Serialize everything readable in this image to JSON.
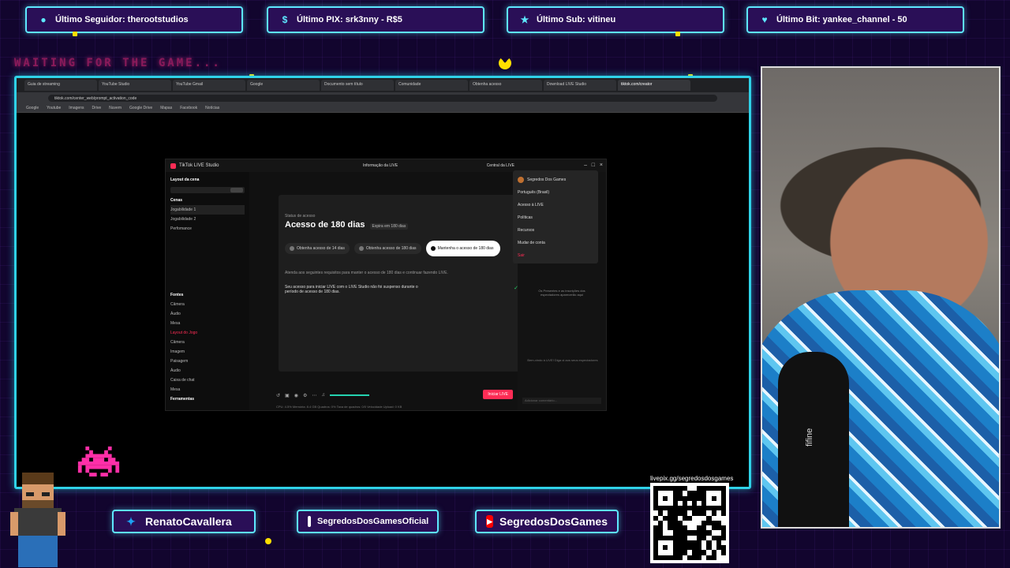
{
  "overlay": {
    "top_bars": [
      {
        "icon": "user-icon",
        "color": "#5ee8ff",
        "text": "Último Seguidor: therootstudios"
      },
      {
        "icon": "dollar-icon",
        "color": "#5ee8ff",
        "text": "Último PIX: srk3nny - R$5"
      },
      {
        "icon": "star-icon",
        "color": "#5ee8ff",
        "text": "Último Sub: vitineu"
      },
      {
        "icon": "heart-icon",
        "color": "#5ee8ff",
        "text": "Último Bit: yankee_channel - 50"
      }
    ],
    "waiting_text": "WAITING FOR THE GAME...",
    "socials": [
      {
        "icon": "twitter-icon",
        "text": "RenatoCavallera"
      },
      {
        "icon": "instagram-icon",
        "text": "SegredosDosGamesOficial"
      },
      {
        "icon": "youtube-icon",
        "text": "SegredosDosGames"
      }
    ],
    "qr_label": "livepix.gg/segredosdosgames",
    "accent": "#5ee8ff",
    "panel_bg": "#2a0f57"
  },
  "browser": {
    "tabs": [
      "Guia de streaming",
      "YouTube Studio",
      "YouTube Gmail",
      "Google",
      "Documento sem título",
      "Comunidade",
      "Obtenha acesso",
      "Download LIVE Studio",
      "tiktok.com/creator"
    ],
    "url": "tiktok.com/center_web/prompt_activation_code",
    "bookmarks": [
      "Google",
      "Youtube",
      "Imagens",
      "Drive",
      "Nuvem",
      "Google Drive",
      "Mapas",
      "Facebook",
      "Notícias"
    ]
  },
  "studio": {
    "app_title": "TikTok LIVE Studio",
    "center_title": "Informação da LIVE",
    "right_title": "Central da LIVE",
    "left_panel": {
      "layout_label": "Layout da cena",
      "scenes_label": "Cenas",
      "scenes": [
        "Jogabilidade 1",
        "Jogabilidade 2",
        "Perfomance"
      ],
      "sources_label": "Fontes",
      "sources_group1": "Câmera",
      "sources": [
        "Áudio",
        "Mesa",
        "Layout do Jogo",
        "Câmera",
        "Imagem"
      ],
      "sources_group2": "Paisagem",
      "sources2": [
        "Áudio",
        "Caixa de chat",
        "Mesa"
      ],
      "tools_label": "Ferramentas"
    },
    "modal": {
      "small_top": "Status de acesso",
      "title": "Acesso de 180 dias",
      "badge": "Expira em 180 dias",
      "pills": [
        "Obtenha acesso de 14 dias",
        "Obtenha acesso de 180 dias",
        "Mantenha o acesso de 180 dias"
      ],
      "desc": "Atenda aos seguintes requisitos para manter o acesso de 180 dias e continuar fazendo LIVE.",
      "requirement": "Seu acesso para iniciar LIVE com o LIVE Studio não foi suspenso durante o período de acesso de 180 dias.",
      "close": "×"
    },
    "go_live": "Iniciar LIVE",
    "status_bar": "CPU: 4.5%   Memória: 8.4 GB   Quadros: 0%   Taxa de quadros: 0/0   Velocidade Upload: 0 KB",
    "dropdown": {
      "user": "Segredos Dos Games",
      "items": [
        "Português (Brasil)",
        "Acesso à LIVE",
        "Políticas",
        "Recursos",
        "Mudar de conta",
        "Sair"
      ]
    },
    "right_note": "Os Presentes e as inscrições dos espectadores aparecerão aqui",
    "right_note2": "Bem-vindo à LIVE! Diga oi aos seus espectadores",
    "chat_placeholder": "Adicionar comentário..."
  },
  "webcam": {
    "mic_brand": "fifine"
  }
}
